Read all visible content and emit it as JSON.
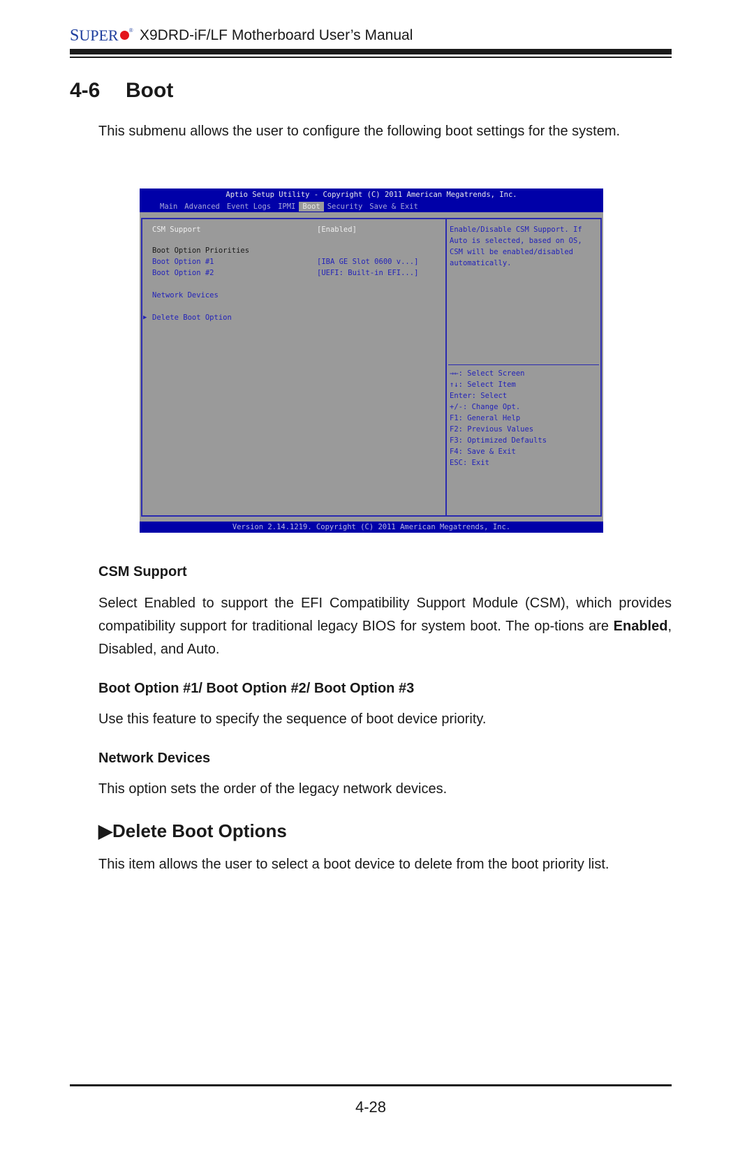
{
  "header": {
    "brand_main": "S",
    "brand_rest": "UPER",
    "brand_reg": "®",
    "manual_title": "X9DRD-iF/LF Motherboard User’s Manual"
  },
  "section": {
    "number": "4-6",
    "title": "Boot",
    "intro": "This submenu allows the user to configure the following boot settings for the system."
  },
  "bios": {
    "title_bar": "Aptio Setup Utility - Copyright (C) 2011 American Megatrends, Inc.",
    "tabs": [
      {
        "label": "Main",
        "active": false
      },
      {
        "label": "Advanced",
        "active": false
      },
      {
        "label": "Event Logs",
        "active": false
      },
      {
        "label": "IPMI",
        "active": false
      },
      {
        "label": "Boot",
        "active": true
      },
      {
        "label": "Security",
        "active": false
      },
      {
        "label": "Save & Exit",
        "active": false
      }
    ],
    "items": {
      "csm_label": "CSM Support",
      "csm_value": "[Enabled]",
      "priorities_label": "Boot Option Priorities",
      "boot1_label": "Boot Option #1",
      "boot1_value": "[IBA GE Slot 0600 v...]",
      "boot2_label": "Boot Option #2",
      "boot2_value": "[UEFI: Built-in EFI...]",
      "network_label": "Network Devices",
      "delete_arrow": "▶",
      "delete_label": "Delete Boot Option"
    },
    "help_lines": [
      "Enable/Disable CSM Support. If",
      "Auto is selected, based on OS,",
      "CSM will be enabled/disabled",
      "automatically."
    ],
    "keys": [
      "→←: Select Screen",
      "↑↓: Select Item",
      "Enter: Select",
      "+/-: Change Opt.",
      "F1: General Help",
      "F2: Previous Values",
      "F3: Optimized Defaults",
      "F4: Save & Exit",
      "ESC: Exit"
    ],
    "footer": "Version 2.14.1219. Copyright (C) 2011 American Megatrends, Inc.",
    "colors": {
      "bar": "#0000a8",
      "panel": "#9a9a9a",
      "highlight_text": "#2323b8"
    }
  },
  "content": {
    "csm_heading": "CSM Support",
    "csm_text_1": "Select Enabled to support the EFI Compatibility Support Module (CSM), which provides compatibility support for traditional legacy BIOS for system boot. The op-tions are ",
    "csm_text_bold": "Enabled",
    "csm_text_2": ", Disabled, and Auto.",
    "boot_heading": "Boot Option #1/ Boot Option #2/ Boot Option #3",
    "boot_text": "Use this feature to specify the sequence of boot device priority.",
    "net_heading": "Network Devices",
    "net_text": "This option sets the order of the legacy network devices.",
    "del_arrow": "▶",
    "del_heading": "Delete Boot Options",
    "del_text": "This item allows the user to select a boot device to delete from the boot priority list."
  },
  "footer": {
    "page_number": "4-28"
  }
}
